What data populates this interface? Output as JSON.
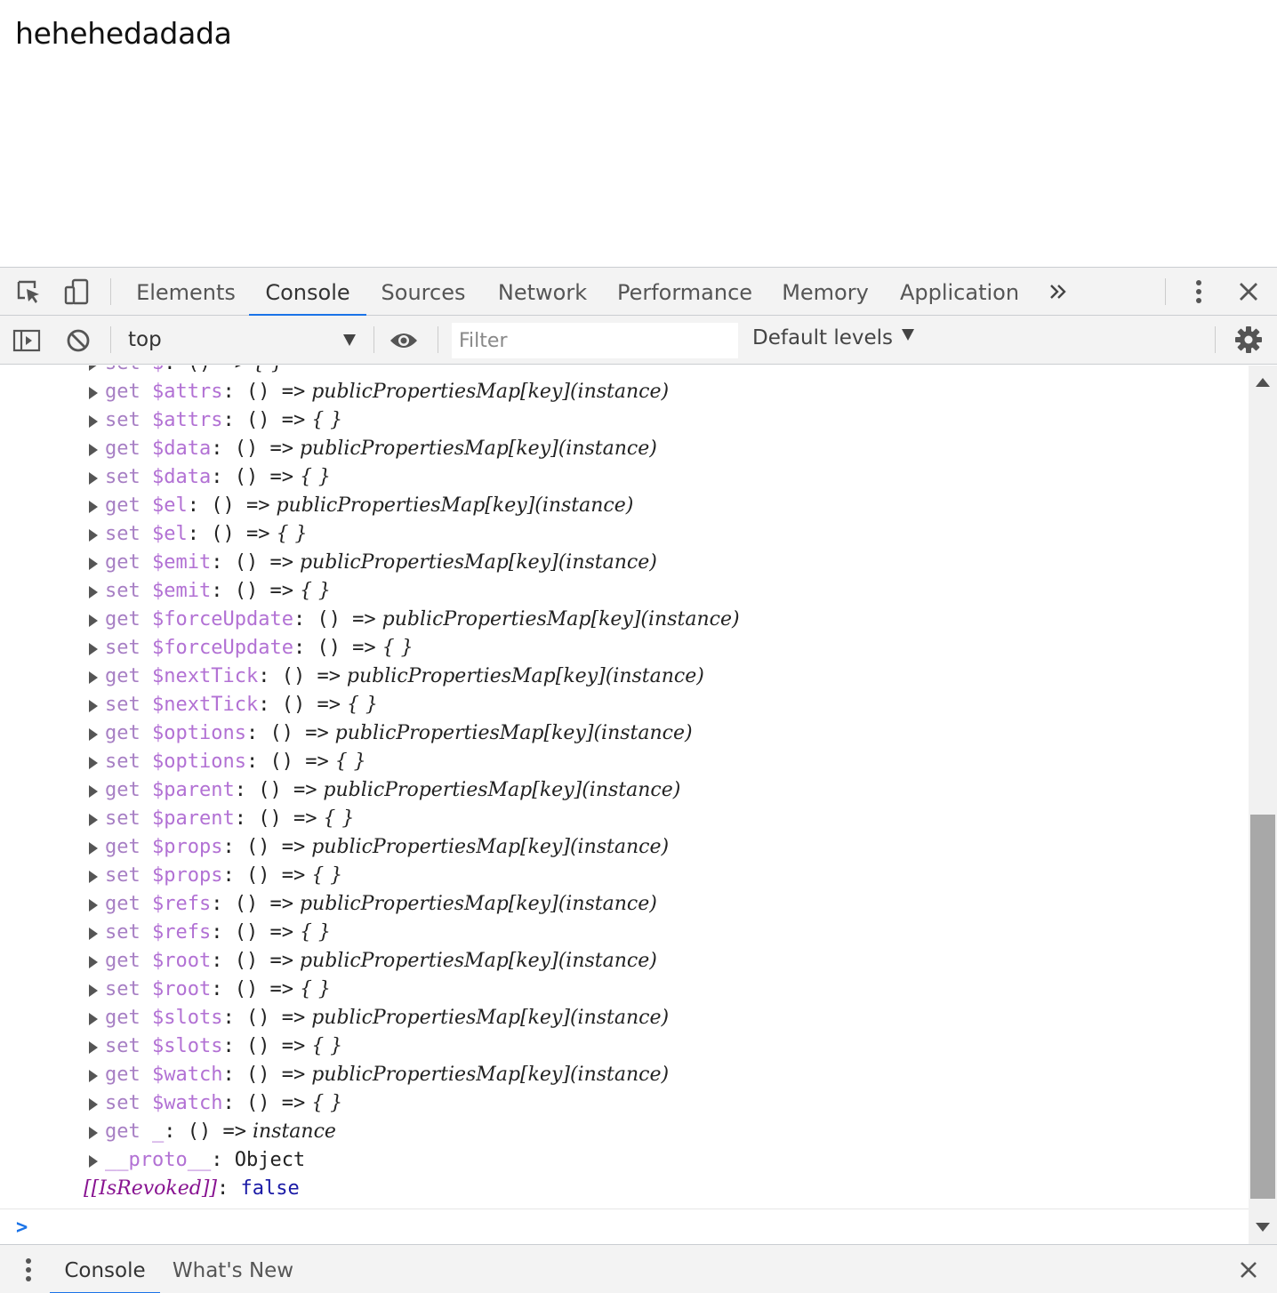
{
  "page": {
    "heading": "hehehedadada"
  },
  "devtools": {
    "tabs": [
      {
        "label": "Elements"
      },
      {
        "label": "Console"
      },
      {
        "label": "Sources"
      },
      {
        "label": "Network"
      },
      {
        "label": "Performance"
      },
      {
        "label": "Memory"
      },
      {
        "label": "Application"
      }
    ],
    "active_tab": "Console",
    "icons": {
      "inspect": "inspect-element-icon",
      "device": "device-toolbar-icon",
      "more_tabs": "double-chevron-icon",
      "menu": "kebab-menu-icon",
      "close": "close-icon"
    }
  },
  "console_toolbar": {
    "context": "top",
    "filter_placeholder": "Filter",
    "levels": "Default levels",
    "icons": [
      "sidebar-toggle-icon",
      "clear-console-icon",
      "eye-icon",
      "gear-icon"
    ]
  },
  "console_lines": [
    {
      "kind": "accessor",
      "mode": "set",
      "key": "$",
      "rest": ": () => { }"
    },
    {
      "kind": "accessor",
      "mode": "get",
      "key": "$attrs",
      "rest": ": () => publicPropertiesMap[key](instance)"
    },
    {
      "kind": "accessor",
      "mode": "set",
      "key": "$attrs",
      "rest": ": () => { }"
    },
    {
      "kind": "accessor",
      "mode": "get",
      "key": "$data",
      "rest": ": () => publicPropertiesMap[key](instance)"
    },
    {
      "kind": "accessor",
      "mode": "set",
      "key": "$data",
      "rest": ": () => { }"
    },
    {
      "kind": "accessor",
      "mode": "get",
      "key": "$el",
      "rest": ": () => publicPropertiesMap[key](instance)"
    },
    {
      "kind": "accessor",
      "mode": "set",
      "key": "$el",
      "rest": ": () => { }"
    },
    {
      "kind": "accessor",
      "mode": "get",
      "key": "$emit",
      "rest": ": () => publicPropertiesMap[key](instance)"
    },
    {
      "kind": "accessor",
      "mode": "set",
      "key": "$emit",
      "rest": ": () => { }"
    },
    {
      "kind": "accessor",
      "mode": "get",
      "key": "$forceUpdate",
      "rest": ": () => publicPropertiesMap[key](instance)"
    },
    {
      "kind": "accessor",
      "mode": "set",
      "key": "$forceUpdate",
      "rest": ": () => { }"
    },
    {
      "kind": "accessor",
      "mode": "get",
      "key": "$nextTick",
      "rest": ": () => publicPropertiesMap[key](instance)"
    },
    {
      "kind": "accessor",
      "mode": "set",
      "key": "$nextTick",
      "rest": ": () => { }"
    },
    {
      "kind": "accessor",
      "mode": "get",
      "key": "$options",
      "rest": ": () => publicPropertiesMap[key](instance)"
    },
    {
      "kind": "accessor",
      "mode": "set",
      "key": "$options",
      "rest": ": () => { }"
    },
    {
      "kind": "accessor",
      "mode": "get",
      "key": "$parent",
      "rest": ": () => publicPropertiesMap[key](instance)"
    },
    {
      "kind": "accessor",
      "mode": "set",
      "key": "$parent",
      "rest": ": () => { }"
    },
    {
      "kind": "accessor",
      "mode": "get",
      "key": "$props",
      "rest": ": () => publicPropertiesMap[key](instance)"
    },
    {
      "kind": "accessor",
      "mode": "set",
      "key": "$props",
      "rest": ": () => { }"
    },
    {
      "kind": "accessor",
      "mode": "get",
      "key": "$refs",
      "rest": ": () => publicPropertiesMap[key](instance)"
    },
    {
      "kind": "accessor",
      "mode": "set",
      "key": "$refs",
      "rest": ": () => { }"
    },
    {
      "kind": "accessor",
      "mode": "get",
      "key": "$root",
      "rest": ": () => publicPropertiesMap[key](instance)"
    },
    {
      "kind": "accessor",
      "mode": "set",
      "key": "$root",
      "rest": ": () => { }"
    },
    {
      "kind": "accessor",
      "mode": "get",
      "key": "$slots",
      "rest": ": () => publicPropertiesMap[key](instance)"
    },
    {
      "kind": "accessor",
      "mode": "set",
      "key": "$slots",
      "rest": ": () => { }"
    },
    {
      "kind": "accessor",
      "mode": "get",
      "key": "$watch",
      "rest": ": () => publicPropertiesMap[key](instance)"
    },
    {
      "kind": "accessor",
      "mode": "set",
      "key": "$watch",
      "rest": ": () => { }"
    },
    {
      "kind": "accessor",
      "mode": "get",
      "key": "_",
      "rest": ": () => instance"
    },
    {
      "kind": "proto",
      "key": "__proto__",
      "rest": ": Object"
    },
    {
      "kind": "internal",
      "key": "[[IsRevoked]]",
      "rest": ": ",
      "value": "false"
    }
  ],
  "drawer": {
    "tabs": [
      {
        "label": "Console"
      },
      {
        "label": "What's New"
      }
    ],
    "icons": [
      "kebab-menu-icon",
      "close-icon"
    ]
  },
  "colors": {
    "accent": "#1a73e8",
    "accessor_keyword": "#a77fc4",
    "property_key": "#b271d4",
    "internal_property": "#881391",
    "boolean": "#1a1aa6"
  }
}
